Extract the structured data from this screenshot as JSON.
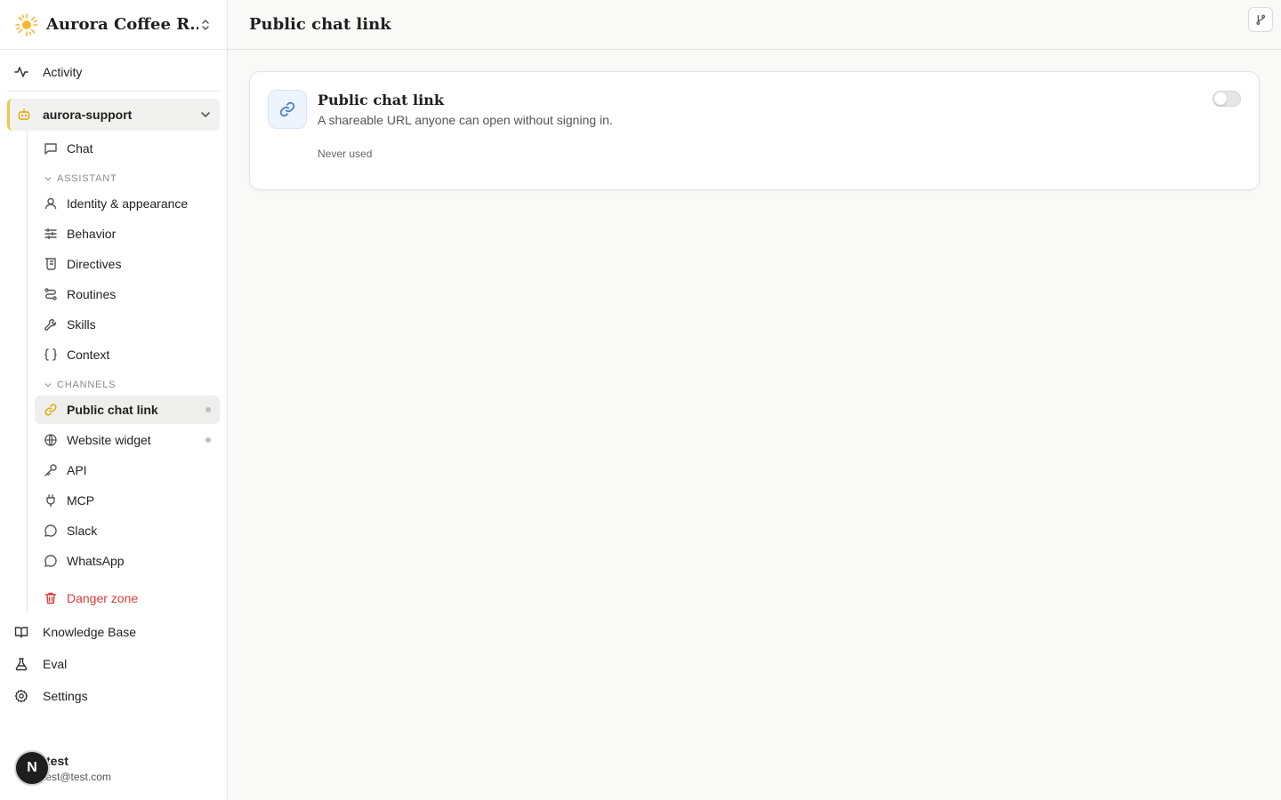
{
  "org": {
    "name": "Aurora Coffee R...",
    "logo_icon": "sun-icon",
    "switch_icon": "chevron-up-down-icon"
  },
  "nav": {
    "activity": "Activity",
    "project": "aurora-support",
    "chat": "Chat",
    "assistant_section": "ASSISTANT",
    "assistant_items": [
      {
        "label": "Identity & appearance",
        "icon": "user-icon"
      },
      {
        "label": "Behavior",
        "icon": "sliders-icon"
      },
      {
        "label": "Directives",
        "icon": "scroll-icon"
      },
      {
        "label": "Routines",
        "icon": "route-icon"
      },
      {
        "label": "Skills",
        "icon": "wrench-icon"
      },
      {
        "label": "Context",
        "icon": "braces-icon"
      }
    ],
    "channels_section": "CHANNELS",
    "channel_items": [
      {
        "label": "Public chat link",
        "icon": "link-icon",
        "active": true,
        "dot": true
      },
      {
        "label": "Website widget",
        "icon": "globe-icon",
        "dot": true
      },
      {
        "label": "API",
        "icon": "key-icon"
      },
      {
        "label": "MCP",
        "icon": "plug-icon"
      },
      {
        "label": "Slack",
        "icon": "message-circle-icon"
      },
      {
        "label": "WhatsApp",
        "icon": "message-circle-icon"
      }
    ],
    "danger": "Danger zone",
    "knowledge_base": "Knowledge Base",
    "eval": "Eval",
    "settings": "Settings"
  },
  "user": {
    "initial": "N",
    "name": "test",
    "email": "test@test.com"
  },
  "header": {
    "title": "Public chat link"
  },
  "card": {
    "title": "Public chat link",
    "description": "A shareable URL anyone can open without signing in.",
    "status": "Never used",
    "enabled": false
  },
  "colors": {
    "accent": "#e0a800",
    "danger": "#dc3b3b",
    "link_icon": "#4a84c9"
  }
}
